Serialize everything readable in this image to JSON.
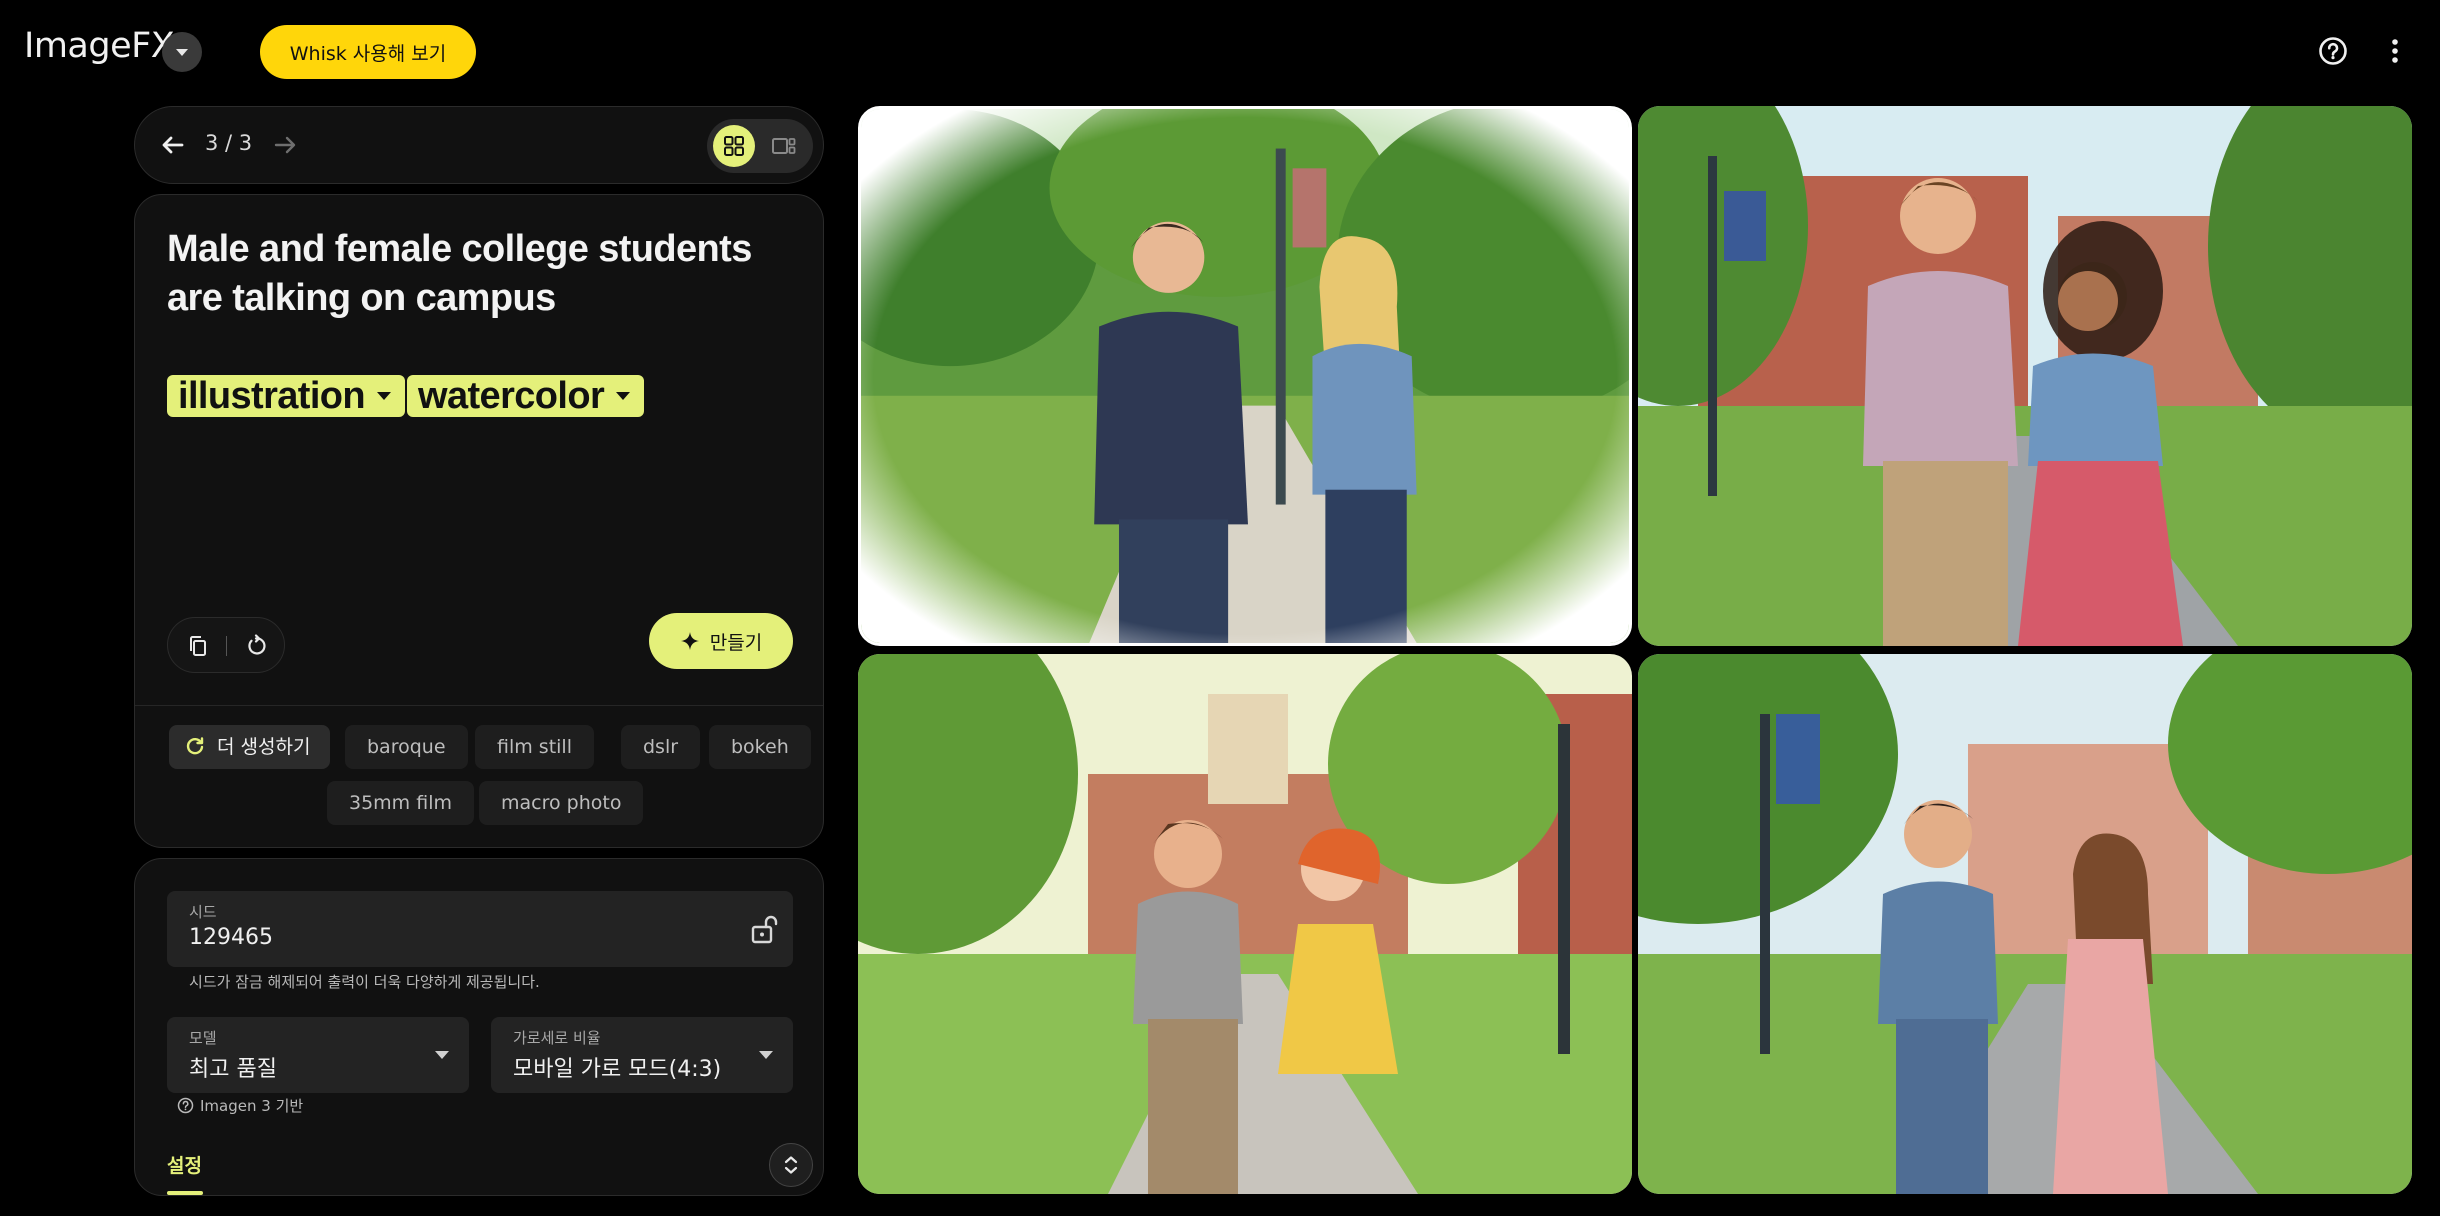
{
  "header": {
    "app_name": "ImageFX",
    "whisk_button": "Whisk 사용해 보기"
  },
  "navigation": {
    "counter": "3 / 3"
  },
  "prompt": {
    "text": "Male and female college students are talking on campus",
    "chips": [
      "illustration",
      "watercolor"
    ],
    "make_button": "만들기"
  },
  "suggestions": {
    "more_label": "더 생성하기",
    "items": [
      "baroque",
      "film still",
      "dslr",
      "bokeh",
      "35mm film",
      "macro photo"
    ]
  },
  "settings": {
    "seed_label": "시드",
    "seed_value": "129465",
    "seed_help": "시드가 잠금 해제되어 출력이 더욱 다양하게 제공됩니다.",
    "model_label": "모델",
    "model_value": "최고 품질",
    "ratio_label": "가로세로 비율",
    "ratio_value": "모바일 가로 모드(4:3)",
    "model_note": "Imagen 3 기반",
    "section_label": "설정"
  },
  "colors": {
    "accent": "#e4f07a",
    "whisk": "#ffd60a",
    "background": "#000000",
    "panel": "#111111"
  }
}
